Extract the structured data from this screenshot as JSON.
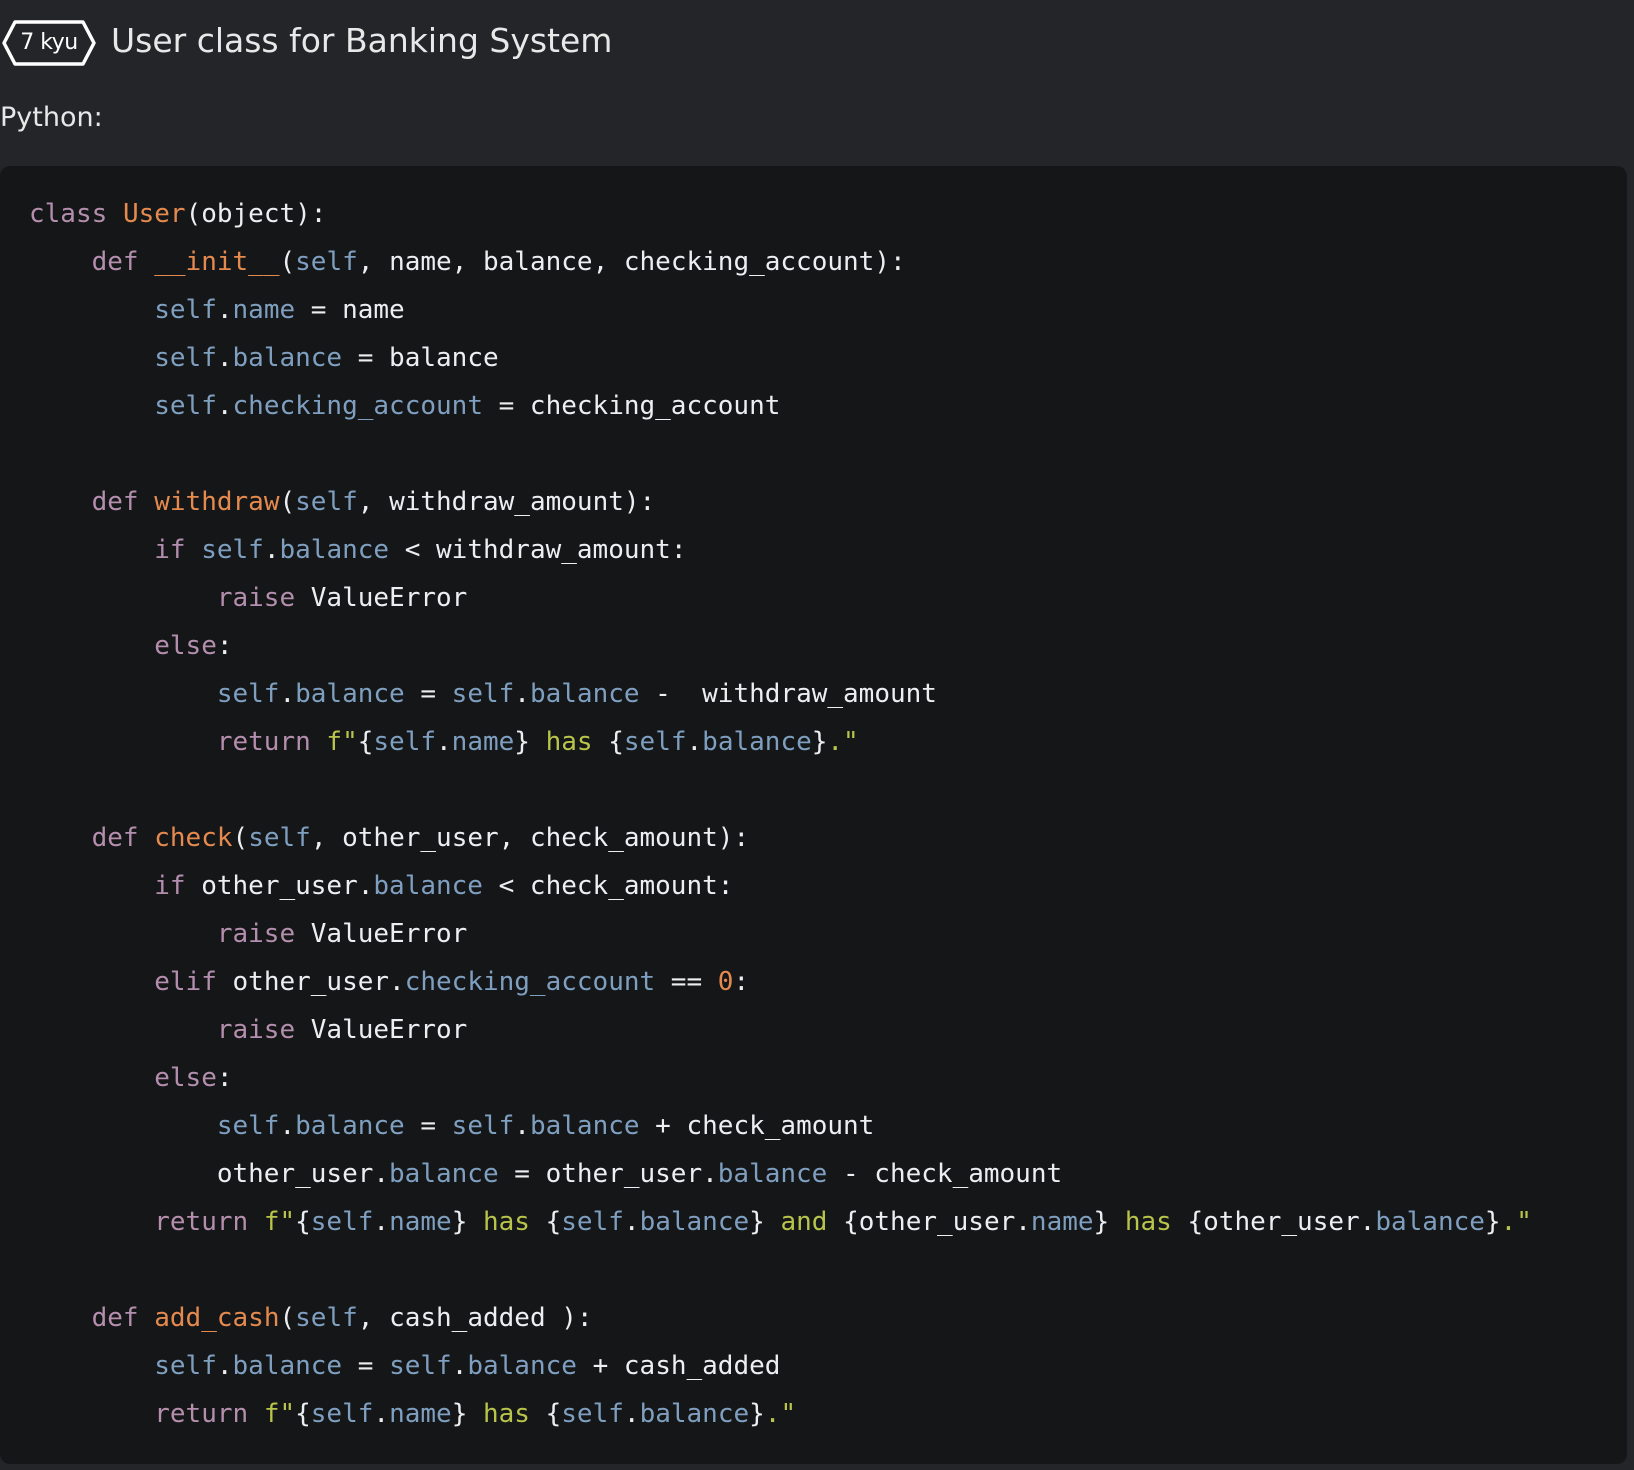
{
  "header": {
    "rank_badge": "7 kyu",
    "title": "User class for Banking System"
  },
  "language_label": "Python:",
  "code": {
    "language": "python",
    "lines": [
      [
        [
          "kw",
          "class"
        ],
        [
          "p",
          " "
        ],
        [
          "fn",
          "User"
        ],
        [
          "p",
          "(object):"
        ]
      ],
      [
        [
          "p",
          "    "
        ],
        [
          "kw",
          "def"
        ],
        [
          "p",
          " "
        ],
        [
          "fn",
          "__init__"
        ],
        [
          "p",
          "("
        ],
        [
          "self",
          "self"
        ],
        [
          "p",
          ", name, balance, checking_account):"
        ]
      ],
      [
        [
          "p",
          "        "
        ],
        [
          "self",
          "self"
        ],
        [
          "p",
          "."
        ],
        [
          "attr",
          "name"
        ],
        [
          "p",
          " = name"
        ]
      ],
      [
        [
          "p",
          "        "
        ],
        [
          "self",
          "self"
        ],
        [
          "p",
          "."
        ],
        [
          "attr",
          "balance"
        ],
        [
          "p",
          " = balance"
        ]
      ],
      [
        [
          "p",
          "        "
        ],
        [
          "self",
          "self"
        ],
        [
          "p",
          "."
        ],
        [
          "attr",
          "checking_account"
        ],
        [
          "p",
          " = checking_account"
        ]
      ],
      [],
      [
        [
          "p",
          "    "
        ],
        [
          "kw",
          "def"
        ],
        [
          "p",
          " "
        ],
        [
          "fn",
          "withdraw"
        ],
        [
          "p",
          "("
        ],
        [
          "self",
          "self"
        ],
        [
          "p",
          ", withdraw_amount):"
        ]
      ],
      [
        [
          "p",
          "        "
        ],
        [
          "kw",
          "if"
        ],
        [
          "p",
          " "
        ],
        [
          "self",
          "self"
        ],
        [
          "p",
          "."
        ],
        [
          "attr",
          "balance"
        ],
        [
          "p",
          " < withdraw_amount:"
        ]
      ],
      [
        [
          "p",
          "            "
        ],
        [
          "kw",
          "raise"
        ],
        [
          "p",
          " ValueError"
        ]
      ],
      [
        [
          "p",
          "        "
        ],
        [
          "kw",
          "else"
        ],
        [
          "p",
          ":"
        ]
      ],
      [
        [
          "p",
          "            "
        ],
        [
          "self",
          "self"
        ],
        [
          "p",
          "."
        ],
        [
          "attr",
          "balance"
        ],
        [
          "p",
          " = "
        ],
        [
          "self",
          "self"
        ],
        [
          "p",
          "."
        ],
        [
          "attr",
          "balance"
        ],
        [
          "p",
          " -  withdraw_amount"
        ]
      ],
      [
        [
          "p",
          "            "
        ],
        [
          "kw",
          "return"
        ],
        [
          "p",
          " "
        ],
        [
          "str",
          "f\""
        ],
        [
          "p",
          "{"
        ],
        [
          "self",
          "self"
        ],
        [
          "p",
          "."
        ],
        [
          "attr",
          "name"
        ],
        [
          "p",
          "}"
        ],
        [
          "str",
          " has "
        ],
        [
          "p",
          "{"
        ],
        [
          "self",
          "self"
        ],
        [
          "p",
          "."
        ],
        [
          "attr",
          "balance"
        ],
        [
          "p",
          "}"
        ],
        [
          "str",
          ".\""
        ]
      ],
      [],
      [
        [
          "p",
          "    "
        ],
        [
          "kw",
          "def"
        ],
        [
          "p",
          " "
        ],
        [
          "fn",
          "check"
        ],
        [
          "p",
          "("
        ],
        [
          "self",
          "self"
        ],
        [
          "p",
          ", other_user, check_amount):"
        ]
      ],
      [
        [
          "p",
          "        "
        ],
        [
          "kw",
          "if"
        ],
        [
          "p",
          " other_user."
        ],
        [
          "attr",
          "balance"
        ],
        [
          "p",
          " < check_amount:"
        ]
      ],
      [
        [
          "p",
          "            "
        ],
        [
          "kw",
          "raise"
        ],
        [
          "p",
          " ValueError"
        ]
      ],
      [
        [
          "p",
          "        "
        ],
        [
          "kw",
          "elif"
        ],
        [
          "p",
          " other_user."
        ],
        [
          "attr",
          "checking_account"
        ],
        [
          "p",
          " == "
        ],
        [
          "num",
          "0"
        ],
        [
          "p",
          ":"
        ]
      ],
      [
        [
          "p",
          "            "
        ],
        [
          "kw",
          "raise"
        ],
        [
          "p",
          " ValueError"
        ]
      ],
      [
        [
          "p",
          "        "
        ],
        [
          "kw",
          "else"
        ],
        [
          "p",
          ":"
        ]
      ],
      [
        [
          "p",
          "            "
        ],
        [
          "self",
          "self"
        ],
        [
          "p",
          "."
        ],
        [
          "attr",
          "balance"
        ],
        [
          "p",
          " = "
        ],
        [
          "self",
          "self"
        ],
        [
          "p",
          "."
        ],
        [
          "attr",
          "balance"
        ],
        [
          "p",
          " + check_amount"
        ]
      ],
      [
        [
          "p",
          "            other_user."
        ],
        [
          "attr",
          "balance"
        ],
        [
          "p",
          " = other_user."
        ],
        [
          "attr",
          "balance"
        ],
        [
          "p",
          " - check_amount"
        ]
      ],
      [
        [
          "p",
          "        "
        ],
        [
          "kw",
          "return"
        ],
        [
          "p",
          " "
        ],
        [
          "str",
          "f\""
        ],
        [
          "p",
          "{"
        ],
        [
          "self",
          "self"
        ],
        [
          "p",
          "."
        ],
        [
          "attr",
          "name"
        ],
        [
          "p",
          "}"
        ],
        [
          "str",
          " has "
        ],
        [
          "p",
          "{"
        ],
        [
          "self",
          "self"
        ],
        [
          "p",
          "."
        ],
        [
          "attr",
          "balance"
        ],
        [
          "p",
          "}"
        ],
        [
          "str",
          " and "
        ],
        [
          "p",
          "{other_user."
        ],
        [
          "attr",
          "name"
        ],
        [
          "p",
          "}"
        ],
        [
          "str",
          " has "
        ],
        [
          "p",
          "{other_user."
        ],
        [
          "attr",
          "balance"
        ],
        [
          "p",
          "}"
        ],
        [
          "str",
          ".\""
        ]
      ],
      [],
      [
        [
          "p",
          "    "
        ],
        [
          "kw",
          "def"
        ],
        [
          "p",
          " "
        ],
        [
          "fn",
          "add_cash"
        ],
        [
          "p",
          "("
        ],
        [
          "self",
          "self"
        ],
        [
          "p",
          ", cash_added ):"
        ]
      ],
      [
        [
          "p",
          "        "
        ],
        [
          "self",
          "self"
        ],
        [
          "p",
          "."
        ],
        [
          "attr",
          "balance"
        ],
        [
          "p",
          " = "
        ],
        [
          "self",
          "self"
        ],
        [
          "p",
          "."
        ],
        [
          "attr",
          "balance"
        ],
        [
          "p",
          " + cash_added"
        ]
      ],
      [
        [
          "p",
          "        "
        ],
        [
          "kw",
          "return"
        ],
        [
          "p",
          " "
        ],
        [
          "str",
          "f\""
        ],
        [
          "p",
          "{"
        ],
        [
          "self",
          "self"
        ],
        [
          "p",
          "."
        ],
        [
          "attr",
          "name"
        ],
        [
          "p",
          "}"
        ],
        [
          "str",
          " has "
        ],
        [
          "p",
          "{"
        ],
        [
          "self",
          "self"
        ],
        [
          "p",
          "."
        ],
        [
          "attr",
          "balance"
        ],
        [
          "p",
          "}"
        ],
        [
          "str",
          ".\""
        ]
      ]
    ]
  },
  "colors": {
    "page_background": "#242528",
    "code_background": "#151618",
    "keyword": "#b48ead",
    "function_name": "#e58a4e",
    "self_and_attribute": "#7f9fc0",
    "string": "#b8c44a",
    "number": "#e58a4e",
    "plain_text": "#eceff1"
  }
}
